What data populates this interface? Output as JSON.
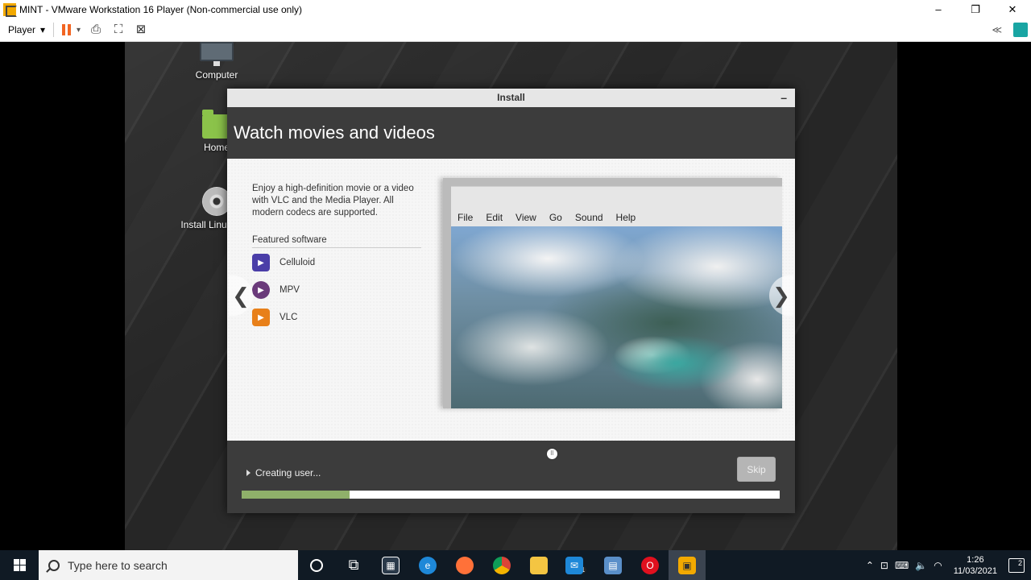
{
  "vmware": {
    "title": "MINT - VMware Workstation 16 Player (Non-commercial use only)",
    "window_controls": {
      "minimize": "–",
      "maximize": "❐",
      "close": "✕"
    },
    "toolbar": {
      "player_menu": "Player",
      "back_label": "≪"
    }
  },
  "desktop": {
    "icons": [
      {
        "label": "Computer"
      },
      {
        "label": "Home"
      },
      {
        "label": "Install Linux Mint"
      }
    ]
  },
  "installer": {
    "window_title": "Install",
    "minimize": "–",
    "heading": "Watch movies and videos",
    "description": "Enjoy a high-definition movie or a video with VLC and the Media Player. All modern codecs are supported.",
    "featured_title": "Featured software",
    "featured": [
      {
        "name": "Celluloid",
        "icon": "celluloid-icon",
        "color": "#4a3ea8"
      },
      {
        "name": "MPV",
        "icon": "mpv-icon",
        "color": "#6a3a7a"
      },
      {
        "name": "VLC",
        "icon": "vlc-icon",
        "color": "#e8801a"
      }
    ],
    "nav_prev": "❮",
    "nav_next": "❯",
    "player_menu": [
      "File",
      "Edit",
      "View",
      "Go",
      "Sound",
      "Help"
    ],
    "status": "Creating user...",
    "skip_label": "Skip",
    "progress": 0.2
  },
  "taskbar": {
    "search_placeholder": "Type here to search",
    "mail_badge": "11",
    "time": "1:26",
    "date": "11/03/2021",
    "notification_count": "2"
  }
}
